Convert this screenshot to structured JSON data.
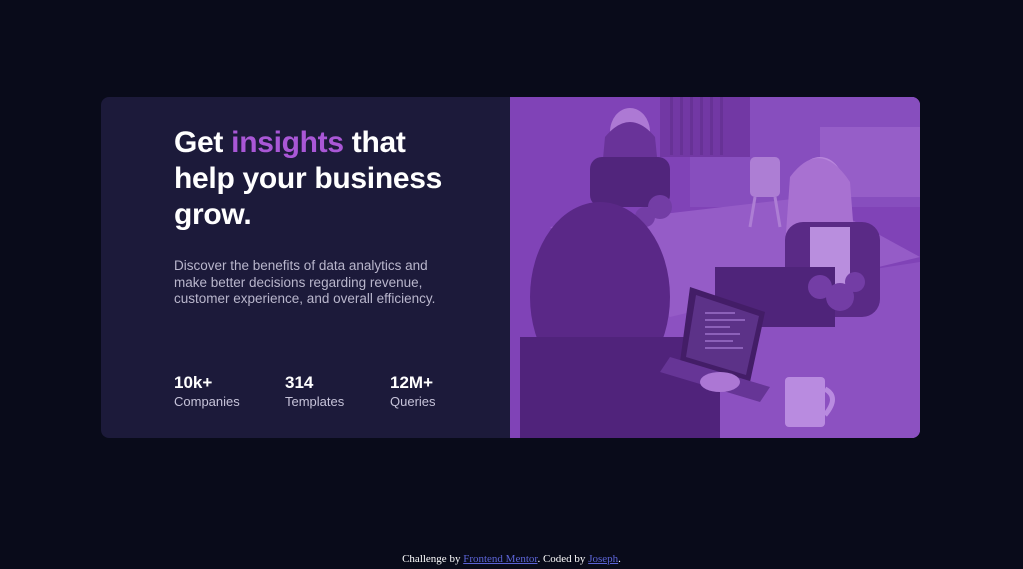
{
  "card": {
    "headline": {
      "before": "Get ",
      "accent": "insights",
      "after": " that help your business grow."
    },
    "description": "Discover the benefits of data analytics and make better decisions regarding revenue, customer experience, and overall efficiency.",
    "stats": [
      {
        "value": "10k+",
        "label": "Companies"
      },
      {
        "value": "314",
        "label": "Templates"
      },
      {
        "value": "12M+",
        "label": "Queries"
      }
    ],
    "image_subject": "office-team-photo",
    "colors": {
      "card_bg": "#1c1a3a",
      "accent": "#a957d6",
      "page_bg": "#090b1a",
      "image_tint": "#7a3fae"
    }
  },
  "footer": {
    "prefix": "Challenge by ",
    "link1": "Frontend Mentor",
    "middle": ". Coded by ",
    "link2": "Joseph",
    "suffix": "."
  }
}
